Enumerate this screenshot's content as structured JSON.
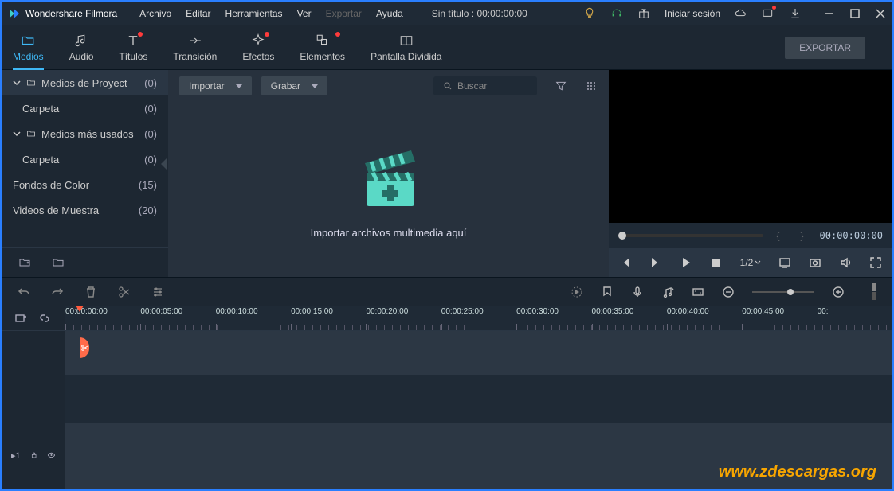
{
  "app": {
    "title": "Wondershare Filmora"
  },
  "menu": {
    "file": "Archivo",
    "edit": "Editar",
    "tools": "Herramientas",
    "view": "Ver",
    "export": "Exportar",
    "help": "Ayuda"
  },
  "project_title": "Sin título : 00:00:00:00",
  "signin": "Iniciar sesión",
  "tabs": {
    "media": "Medios",
    "audio": "Audio",
    "titles": "Títulos",
    "transition": "Transición",
    "effects": "Efectos",
    "elements": "Elementos",
    "split": "Pantalla Dividida"
  },
  "export_btn": "EXPORTAR",
  "sidebar": {
    "project": {
      "label": "Medios de Proyect",
      "count": "(0)"
    },
    "folder1": {
      "label": "Carpeta",
      "count": "(0)"
    },
    "most_used": {
      "label": "Medios más usados",
      "count": "(0)"
    },
    "folder2": {
      "label": "Carpeta",
      "count": "(0)"
    },
    "color_bg": {
      "label": "Fondos de Color",
      "count": "(15)"
    },
    "samples": {
      "label": "Videos de Muestra",
      "count": "(20)"
    }
  },
  "panel": {
    "import": "Importar",
    "record": "Grabar",
    "search_placeholder": "Buscar",
    "drop_msg": "Importar archivos multimedia aquí"
  },
  "preview": {
    "timecode": "00:00:00:00",
    "zoom": "1/2"
  },
  "timeline": {
    "marks": [
      "00:00:00:00",
      "00:00:05:00",
      "00:00:10:00",
      "00:00:15:00",
      "00:00:20:00",
      "00:00:25:00",
      "00:00:30:00",
      "00:00:35:00",
      "00:00:40:00",
      "00:00:45:00",
      "00:"
    ],
    "track1": "▸1"
  },
  "watermark": "www.zdescargas.org"
}
